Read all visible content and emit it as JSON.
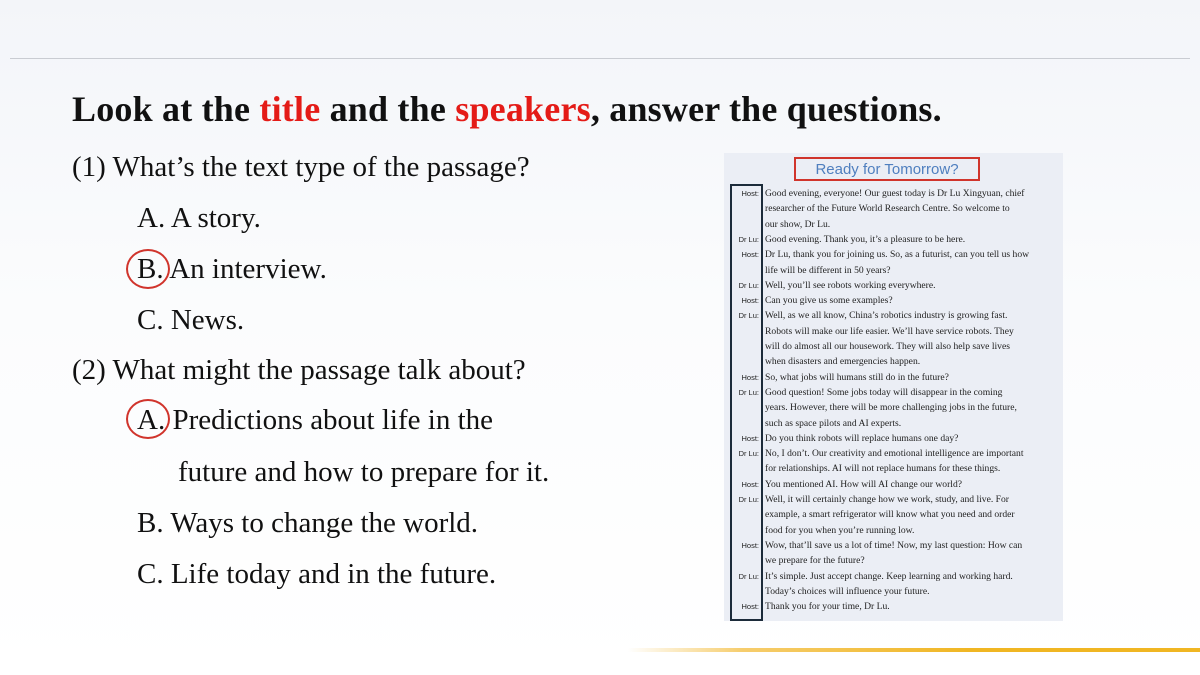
{
  "heading": {
    "part1": "Look at the ",
    "highlight1": "title",
    "part2": " and the ",
    "highlight2": "speakers",
    "part3": ", answer the questions."
  },
  "questions": [
    {
      "prompt": "(1) What’s the text type of the passage?",
      "options": [
        {
          "letter": "A.",
          "text": " A story."
        },
        {
          "letter": "B.",
          "text": " An interview."
        },
        {
          "letter": "C.",
          "text": " News."
        }
      ]
    },
    {
      "prompt": "(2) What might the passage talk about?",
      "options": [
        {
          "letter": "A.",
          "text": " Predictions about life in the",
          "text2": "future and how to prepare for it."
        },
        {
          "letter": "B.",
          "text": " Ways to change the world."
        },
        {
          "letter": "C.",
          "text": " Life today and in the future."
        }
      ]
    }
  ],
  "panel": {
    "title": "Ready for Tomorrow?",
    "lines": [
      {
        "speaker": "Host:",
        "text": "Good evening, everyone! Our guest today is Dr Lu Xingyuan, chief"
      },
      {
        "speaker": "",
        "text": "researcher of the Future World Research Centre. So welcome to"
      },
      {
        "speaker": "",
        "text": "our show, Dr Lu."
      },
      {
        "speaker": "Dr Lu:",
        "text": "Good evening. Thank you, it’s a pleasure to be here."
      },
      {
        "speaker": "Host:",
        "text": "Dr Lu, thank you for joining us. So, as a futurist, can you tell us how"
      },
      {
        "speaker": "",
        "text": "life will be different in 50 years?"
      },
      {
        "speaker": "Dr Lu:",
        "text": "Well, you’ll see robots working everywhere."
      },
      {
        "speaker": "Host:",
        "text": "Can you give us some examples?"
      },
      {
        "speaker": "Dr Lu:",
        "text": "Well, as we all know, China’s robotics industry is growing fast."
      },
      {
        "speaker": "",
        "text": "Robots will make our life easier. We’ll have service robots. They"
      },
      {
        "speaker": "",
        "text": "will do almost all our housework. They will also help save lives"
      },
      {
        "speaker": "",
        "text": "when disasters and emergencies happen."
      },
      {
        "speaker": "Host:",
        "text": "So, what jobs will humans still do in the future?"
      },
      {
        "speaker": "Dr Lu:",
        "text": "Good question! Some jobs today will disappear in the coming"
      },
      {
        "speaker": "",
        "text": "years. However, there will be more challenging jobs in the future,"
      },
      {
        "speaker": "",
        "text": "such as space pilots and AI experts."
      },
      {
        "speaker": "Host:",
        "text": "Do you think robots will replace humans one day?"
      },
      {
        "speaker": "Dr Lu:",
        "text": "No, I don’t. Our creativity and emotional intelligence are important"
      },
      {
        "speaker": "",
        "text": "for relationships. AI will not replace humans for these things."
      },
      {
        "speaker": "Host:",
        "text": "You mentioned AI. How will AI change our world?"
      },
      {
        "speaker": "Dr Lu:",
        "text": "Well, it will certainly change how we work, study, and live. For"
      },
      {
        "speaker": "",
        "text": "example, a smart refrigerator will know what you need and order"
      },
      {
        "speaker": "",
        "text": "food for you when you’re running low."
      },
      {
        "speaker": "Host:",
        "text": "Wow, that’ll save us a lot of time! Now, my last question: How can"
      },
      {
        "speaker": "",
        "text": "we prepare for the future?"
      },
      {
        "speaker": "Dr Lu:",
        "text": "It’s simple. Just accept change. Keep learning and working hard."
      },
      {
        "speaker": "",
        "text": "Today’s choices will influence your future."
      },
      {
        "speaker": "Host:",
        "text": "Thank you for your time, Dr Lu."
      }
    ]
  }
}
